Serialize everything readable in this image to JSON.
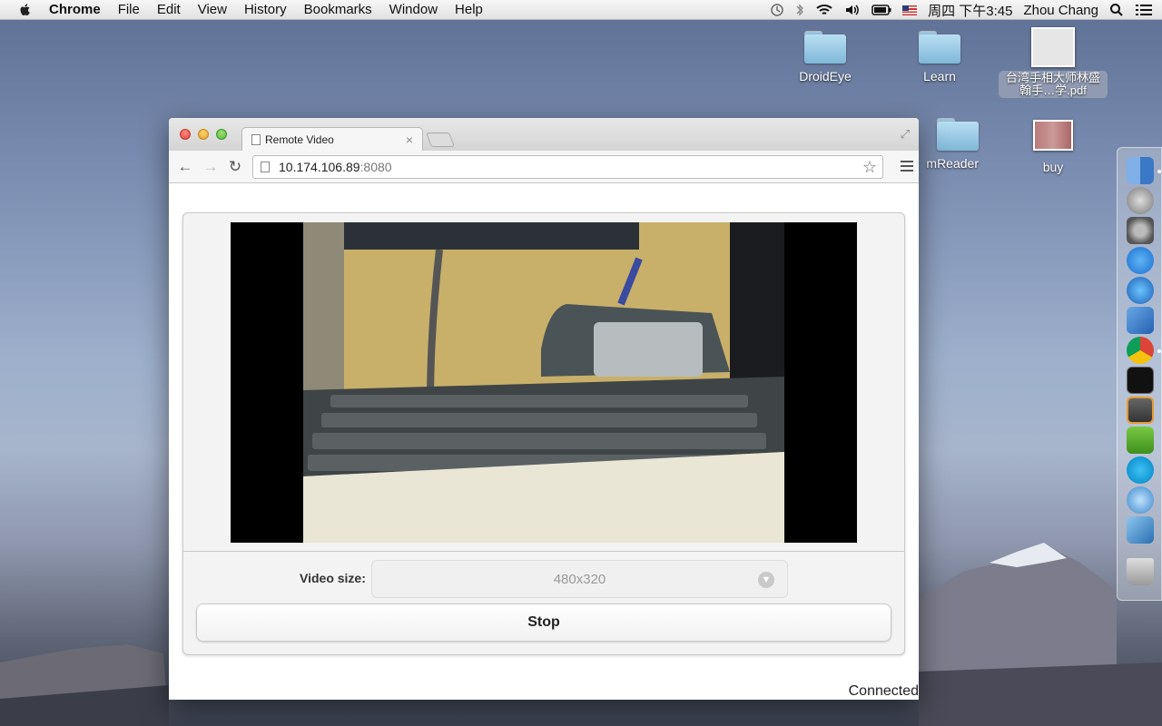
{
  "menubar": {
    "app_name": "Chrome",
    "items": [
      "File",
      "Edit",
      "View",
      "History",
      "Bookmarks",
      "Window",
      "Help"
    ],
    "clock": "周四 下午3:45",
    "user": "Zhou Chang"
  },
  "desktop": {
    "icons": [
      "DroidEye",
      "Learn",
      "台湾手相大师林盛翰手…学.pdf",
      "mReader",
      "buy"
    ]
  },
  "browser": {
    "tab_title": "Remote Video",
    "url_host": "10.174.106.89",
    "url_port": ":8080"
  },
  "page": {
    "video_size_label": "Video size:",
    "video_size_value": "480x320",
    "stop_label": "Stop",
    "status": "Connected"
  }
}
